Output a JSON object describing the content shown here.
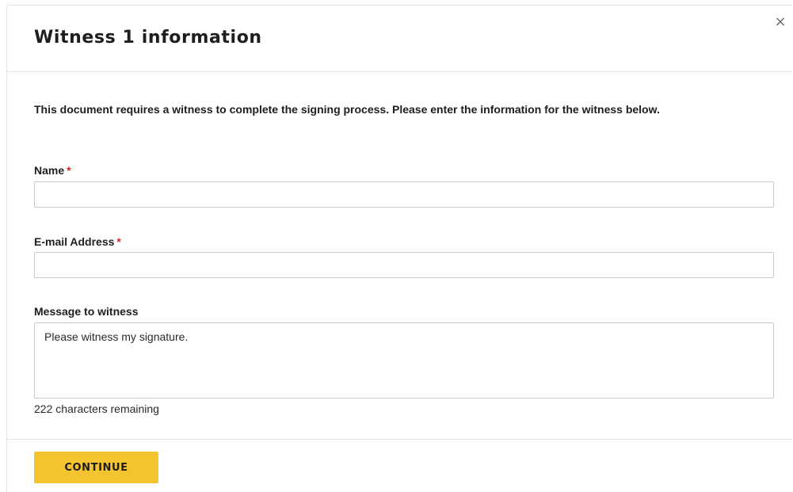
{
  "dialog": {
    "title": "Witness 1 information",
    "close_icon": "close-icon",
    "close_glyph": "×"
  },
  "intro_text": "This document requires a witness to complete the signing process. Please enter the information for the witness below.",
  "form": {
    "name": {
      "label": "Name",
      "required_marker": "*",
      "value": ""
    },
    "email": {
      "label": "E-mail Address",
      "required_marker": "*",
      "value": ""
    },
    "message": {
      "label": "Message to witness",
      "value": "Please witness my signature.",
      "remaining_text": "222 characters remaining"
    }
  },
  "actions": {
    "continue_label": "CONTINUE"
  },
  "colors": {
    "button_background": "#f4c430",
    "required_marker": "#cf2a2a"
  }
}
